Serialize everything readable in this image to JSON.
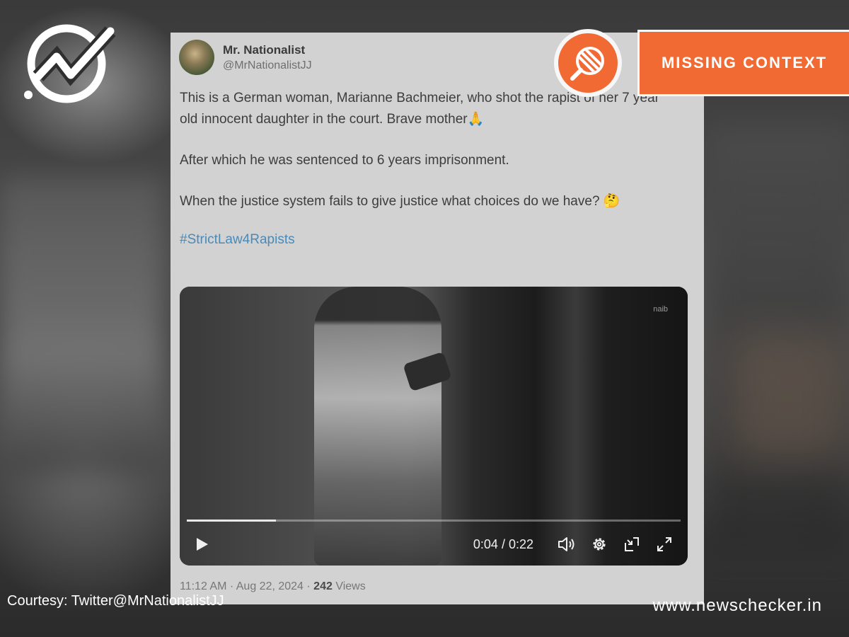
{
  "brand": {
    "logo_icon": "newschecker-check-logo-icon",
    "site_url": "www.newschecker.in",
    "accent_color": "#f26a33"
  },
  "verdict": {
    "label": "MISSING CONTEXT",
    "icon": "magnifier-stripes-icon"
  },
  "tweet": {
    "author_name": "Mr. Nationalist",
    "author_handle": "@MrNationalistJJ",
    "paragraphs": [
      "This is a German woman, Marianne Bachmeier, who shot the rapist of her 7 year old innocent daughter in the court. Brave mother🙏",
      "After which he was sentenced to 6 years imprisonment.",
      "When the justice system fails to give justice what choices do we have? 🤔"
    ],
    "hashtag": "#StrictLaw4Rapists",
    "timestamp": "11:12 AM · Aug 22, 2024 · ",
    "views_count": "242",
    "views_label": " Views"
  },
  "video": {
    "watermark": "naib",
    "current_time": "0:04",
    "separator": " / ",
    "duration": "0:22",
    "progress_fraction": 0.18,
    "icons": [
      "play-icon",
      "volume-icon",
      "settings-gear-icon",
      "exit-fullscreen-icon",
      "expand-icon"
    ]
  },
  "courtesy": "Courtesy: Twitter@MrNationalistJJ"
}
